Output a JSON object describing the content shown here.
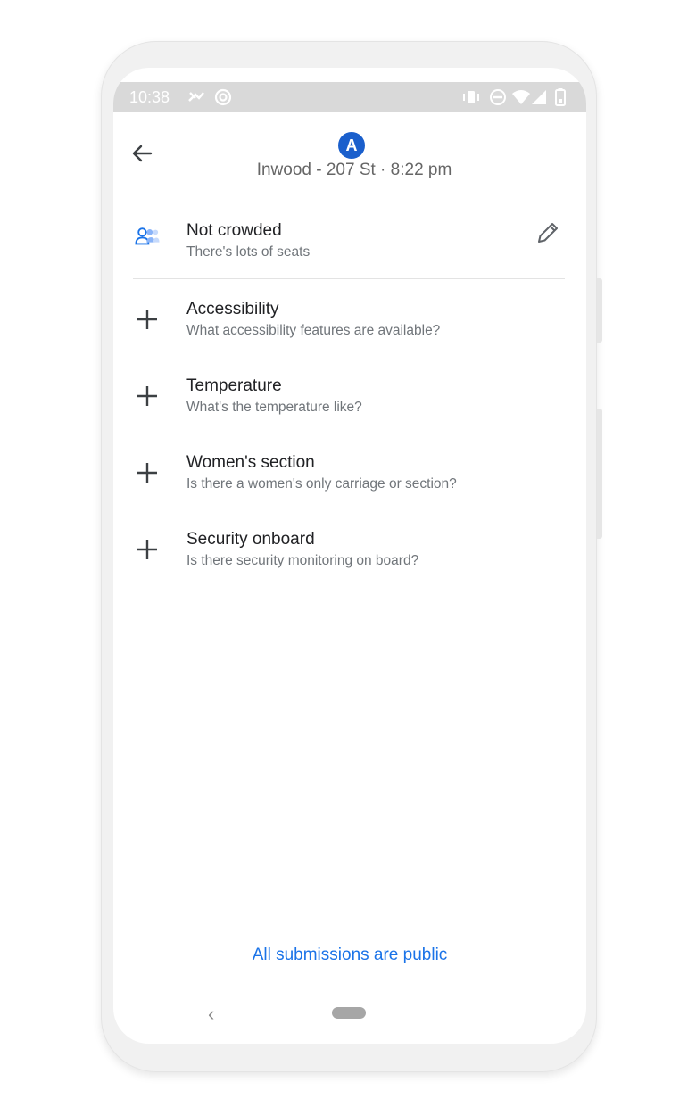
{
  "status_bar": {
    "time": "10:38",
    "icons": [
      "phone-missed-icon",
      "focus-icon",
      "vibrate-icon",
      "do-not-disturb-icon",
      "wifi-icon",
      "signal-icon",
      "battery-icon"
    ]
  },
  "header": {
    "line_badge": "A",
    "line_color": "#1a5fcc",
    "subtitle": "Inwood - 207 St · 8:22 pm"
  },
  "crowd": {
    "title": "Not crowded",
    "description": "There's lots of seats",
    "icon": "people-icon",
    "edit_icon": "pencil-icon"
  },
  "items": [
    {
      "title": "Accessibility",
      "description": "What accessibility features are available?",
      "icon": "plus-icon"
    },
    {
      "title": "Temperature",
      "description": "What's the temperature like?",
      "icon": "plus-icon"
    },
    {
      "title": "Women's section",
      "description": "Is there a women's only carriage or section?",
      "icon": "plus-icon"
    },
    {
      "title": "Security onboard",
      "description": "Is there security monitoring on board?",
      "icon": "plus-icon"
    }
  ],
  "footer": {
    "public_note": "All submissions are public",
    "accent": "#1a73e8"
  }
}
